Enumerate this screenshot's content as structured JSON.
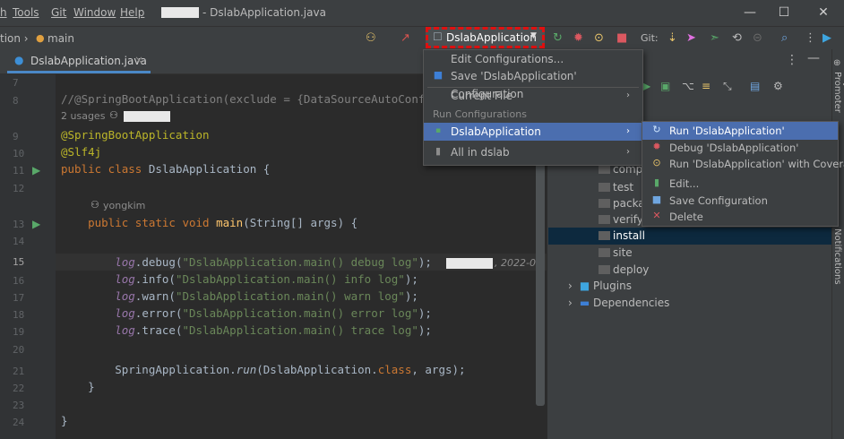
{
  "titlebar": {
    "menus": [
      "Tools",
      "Git",
      "Window",
      "Help"
    ],
    "title": "- DslabApplication.java",
    "winbtns": [
      "—",
      "☐",
      "✕"
    ]
  },
  "toolbar": {
    "breadcrumb_prefix": "tion ›",
    "branch": "main",
    "run_config": "DslabApplication",
    "git_label": "Git:"
  },
  "editor": {
    "tab": "DslabApplication.java",
    "lines": [
      "7",
      "8",
      "",
      "9",
      "10",
      "11",
      "12",
      "",
      "13",
      "14",
      "15",
      "16",
      "17",
      "18",
      "19",
      "20",
      "21",
      "22",
      "23",
      "24"
    ],
    "usages": "2 usages",
    "author": "yongkim",
    "date_hint": ", 2022-0"
  },
  "maven": {
    "items": [
      "compi",
      "test",
      "packag",
      "verify",
      "install",
      "site",
      "deploy",
      "Plugins",
      "Dependencies"
    ]
  },
  "menu1": {
    "items": [
      "Edit Configurations...",
      "Save 'DslabApplication' Configuration",
      "Current File",
      "DslabApplication",
      "All in dslab"
    ],
    "section": "Run Configurations"
  },
  "menu2": {
    "items": [
      "Run 'DslabApplication'",
      "Debug 'DslabApplication'",
      "Run 'DslabApplication' with Coverage",
      "Edit...",
      "Save Configuration",
      "Delete"
    ]
  },
  "sidebar": {
    "keypromoter": "Key Promoter",
    "notifications": "Notifications"
  }
}
